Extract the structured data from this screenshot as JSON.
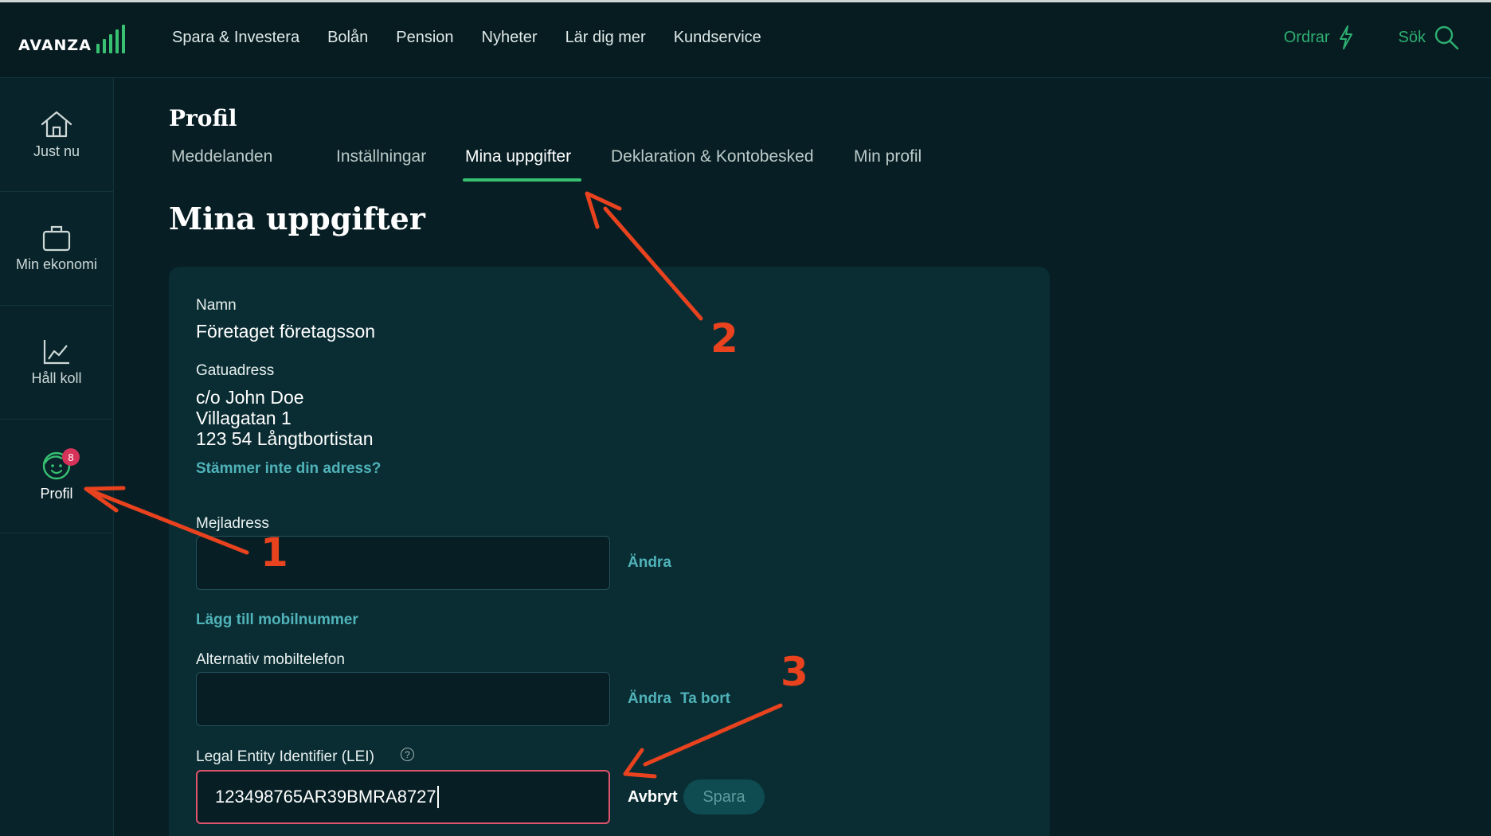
{
  "header": {
    "logo_text": "AVANZA",
    "nav": [
      "Spara & Investera",
      "Bolån",
      "Pension",
      "Nyheter",
      "Lär dig mer",
      "Kundservice"
    ],
    "orders_label": "Ordrar",
    "search_label": "Sök",
    "accent_color": "#38c172"
  },
  "sidebar": {
    "items": [
      {
        "label": "Just nu",
        "icon": "home-icon"
      },
      {
        "label": "Min ekonomi",
        "icon": "briefcase-icon"
      },
      {
        "label": "Håll koll",
        "icon": "line-chart-icon"
      },
      {
        "label": "Profil",
        "icon": "profile-face-icon",
        "badge": "8",
        "active": true
      }
    ]
  },
  "profile": {
    "title": "Profil",
    "tabs": [
      "Meddelanden",
      "Inställningar",
      "Mina uppgifter",
      "Deklaration & Kontobesked",
      "Min profil"
    ],
    "active_tab": "Mina uppgifter"
  },
  "page": {
    "heading": "Mina uppgifter"
  },
  "form": {
    "name_label": "Namn",
    "name_value": "Företaget företagsson",
    "address_label": "Gatuadress",
    "address_line1": "c/o John Doe",
    "address_line2": "Villagatan 1",
    "address_line3": "123 54 Långtbortistan",
    "address_wrong_link": "Stämmer inte din adress?",
    "email_label": "Mejladress",
    "email_value": "",
    "email_change": "Ändra",
    "add_mobile_link": "Lägg till mobilnummer",
    "alt_phone_label": "Alternativ mobiltelefon",
    "alt_phone_value": "",
    "alt_phone_change": "Ändra",
    "alt_phone_remove": "Ta bort",
    "lei_label": "Legal Entity Identifier (LEI)",
    "lei_help": "?",
    "lei_value": "123498765AR39BMRA8727",
    "cancel": "Avbryt",
    "save": "Spara"
  },
  "annotations": {
    "numbers": [
      "1",
      "2",
      "3"
    ],
    "color": "#e8421e"
  }
}
